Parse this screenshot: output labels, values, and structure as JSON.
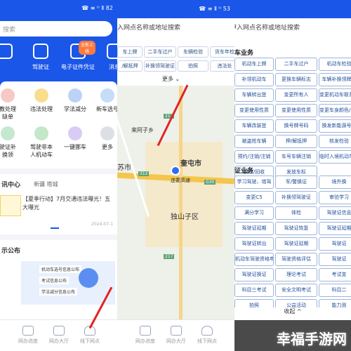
{
  "panel1": {
    "status": {
      "time": "",
      "signal": "☎ ≡ ᵗᴵ Ⅱ 82"
    },
    "search_placeholder": "搜索",
    "top_items": [
      {
        "label": "",
        "icon": "car-icon"
      },
      {
        "label": "驾驶证",
        "icon": "license-icon"
      },
      {
        "label": "电子证件凭证",
        "icon": "card-icon",
        "badge": "全新上线"
      },
      {
        "label": "消息",
        "icon": "message-icon"
      }
    ],
    "grid_row1": [
      "教处理\n缺单",
      "违法处理",
      "学法减分",
      "新车选号"
    ],
    "grid_row2": [
      "驶证补\n换领",
      "驾驶非本\n人机动车",
      "一键挪车",
      "更多"
    ],
    "news_section": {
      "title": "讯中心",
      "tab": "新疆 塔城",
      "headline": "【夏季行动】7月交通违法曝光！五大曝光",
      "date": "2024-07-1"
    },
    "notice_title": "示公布",
    "notice_items": [
      "机动车选号信息公布",
      "考试信息公布",
      "学法减分信息公布"
    ],
    "bottom_nav": [
      "网办进度",
      "网办大厅",
      "线下网点"
    ]
  },
  "panel2": {
    "status": {
      "signal": "☎ ≡ Ⅱ ᵗᴵ 53"
    },
    "search_placeholder": "入网点名称或地址搜索",
    "segments": [
      "车上牌",
      "二手车过户",
      "车辆检验",
      "货车年检",
      "/解抵押",
      "补换领驾驶证",
      "拍照",
      "违法处"
    ],
    "more": "更多",
    "map_labels": {
      "village": "来阿子乡",
      "city": "奎屯市",
      "district": "独山子区",
      "left_city": "苏市",
      "road": "连霍高速",
      "shield1": "217",
      "shield2": "312",
      "shield3": "G30",
      "shield4": "217"
    },
    "bottom_nav": [
      "网办进度",
      "网办大厅",
      "线下网点"
    ]
  },
  "panel3": {
    "search_placeholder": "伊入网点名称或地址搜索",
    "section1": "车业务",
    "section1_items": [
      "机动车上牌",
      "二手车过户",
      "机动车检验",
      "补领机动车",
      "更换车辆标志",
      "车辆补换领牌证",
      "车辆转出登",
      "变更所有人",
      "变更机动车联系方式",
      "变更使用性质",
      "变更使用性质",
      "变更车身颜色/车架",
      "车辆改装登",
      "换号牌号码",
      "换发新能源号牌",
      "被盗抢车辆",
      "押/解抵押",
      "核发检验",
      "预约/注销/注销",
      "车号车辆注销",
      "临时入境机动车业务",
      "换改/回收",
      "发放车标",
      "",
      ""
    ],
    "section2": "证业务",
    "section2_items": [
      "学习驾驶、增驾",
      "军/警换证",
      "境外换",
      "变更C5",
      "补换领驾驶证",
      "审验学习",
      "满分学习",
      "体检",
      "驾驶证信息",
      "驾驶证延期",
      "驾驶证恢复",
      "驾驶证延期",
      "驾驶证转出",
      "驾驶证延期",
      "驾驶证",
      "机动车驾驶资格申请",
      "驾驶资格评估",
      "驾驶证",
      "驾驶证换证",
      "理论考试",
      "考试变",
      "科目三考试",
      "安全文明考试",
      "科目二",
      "拍照",
      "公益活动",
      "能力测"
    ],
    "collapse": "收起 ^"
  },
  "watermark": "幸福手游网",
  "colors": {
    "brand_blue": "#1a56e8",
    "arrow_red": "#e02424",
    "service_border": "#9fb4da"
  }
}
